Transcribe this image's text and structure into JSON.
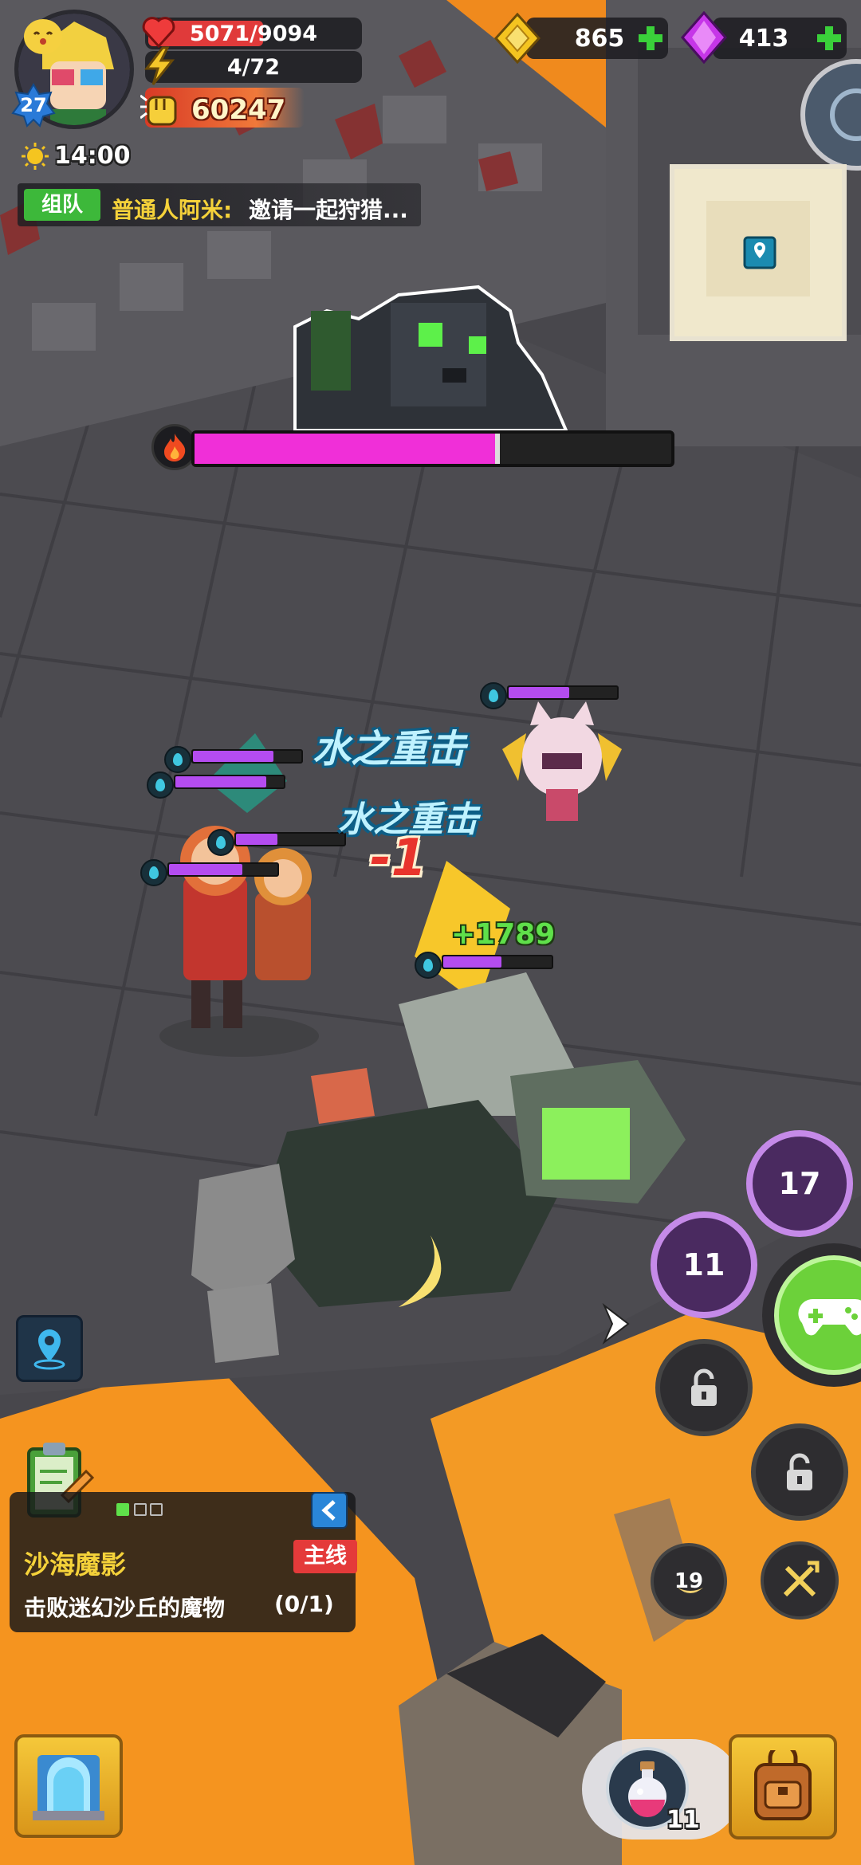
{
  "player": {
    "level": "27",
    "hp": "5071/9094",
    "energy": "4/72",
    "power": "60247",
    "time": "14:00"
  },
  "currency": {
    "gold": "865",
    "gems": "413"
  },
  "chat": {
    "tag": "组队",
    "sender": "普通人阿米:",
    "message": "邀请一起狩猎..."
  },
  "boss": {
    "hp_fraction": 0.64,
    "element_icon": "fire-icon"
  },
  "combat_text": {
    "skill_1": "水之重击",
    "skill_2": "水之重击",
    "damage": "-1",
    "heal": "+1789"
  },
  "skills": {
    "skill_a_cooldown": "17",
    "skill_b_cooldown": "11",
    "skill_c_cooldown": "19"
  },
  "quest": {
    "title": "沙海魔影",
    "badge": "主线",
    "objective": "击败迷幻沙丘的魔物",
    "progress": "(0/1)"
  },
  "potion": {
    "count": "11"
  },
  "colors": {
    "hp_red": "#e03a3a",
    "boss_bar": "#f02fd8",
    "ally_bar": "#b44cf0",
    "heal_green": "#5fe04a",
    "damage_red": "#e8342c",
    "lava": "#f28a1c"
  }
}
